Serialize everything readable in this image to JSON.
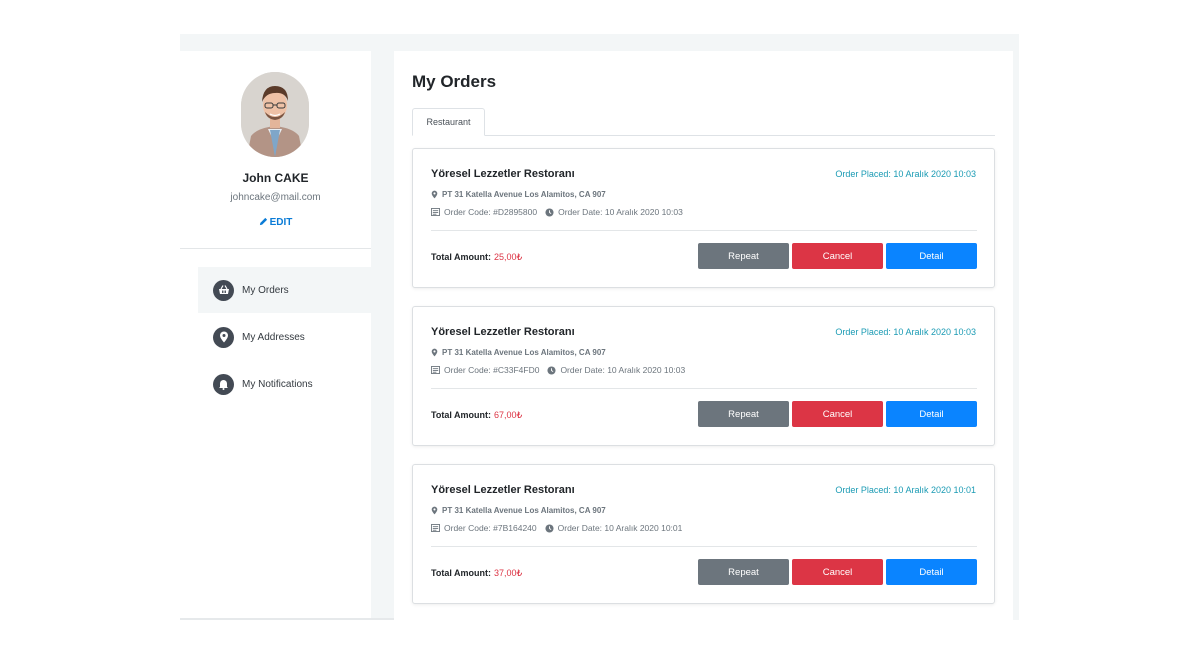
{
  "profile": {
    "name": "John CAKE",
    "email": "johncake@mail.com",
    "edit_label": "EDIT"
  },
  "sidebar": {
    "items": [
      {
        "label": "My Orders",
        "icon": "basket-icon",
        "active": true
      },
      {
        "label": "My Addresses",
        "icon": "location-pin-icon",
        "active": false
      },
      {
        "label": "My Notifications",
        "icon": "bell-icon",
        "active": false
      }
    ]
  },
  "main": {
    "title": "My Orders",
    "tabs": [
      {
        "label": "Restaurant"
      }
    ]
  },
  "orders": [
    {
      "restaurant": "Yöresel Lezzetler Restoranı",
      "placed": "Order Placed: 10 Aralık 2020 10:03",
      "address": "PT 31 Katella Avenue Los Alamitos, CA 907",
      "code": "Order Code: #D2895800",
      "date": "Order Date: 10 Aralık 2020 10:03",
      "total_label": "Total Amount:",
      "total": "25,00₺",
      "repeat": "Repeat",
      "cancel": "Cancel",
      "detail": "Detail"
    },
    {
      "restaurant": "Yöresel Lezzetler Restoranı",
      "placed": "Order Placed: 10 Aralık 2020 10:03",
      "address": "PT 31 Katella Avenue Los Alamitos, CA 907",
      "code": "Order Code: #C33F4FD0",
      "date": "Order Date: 10 Aralık 2020 10:03",
      "total_label": "Total Amount:",
      "total": "67,00₺",
      "repeat": "Repeat",
      "cancel": "Cancel",
      "detail": "Detail"
    },
    {
      "restaurant": "Yöresel Lezzetler Restoranı",
      "placed": "Order Placed: 10 Aralık 2020 10:01",
      "address": "PT 31 Katella Avenue Los Alamitos, CA 907",
      "code": "Order Code: #7B164240",
      "date": "Order Date: 10 Aralık 2020 10:01",
      "total_label": "Total Amount:",
      "total": "37,00₺",
      "repeat": "Repeat",
      "cancel": "Cancel",
      "detail": "Detail"
    }
  ],
  "colors": {
    "accent": "#0a84ff",
    "danger": "#dc3545",
    "secondary": "#6c757d",
    "info": "#1b9bb4"
  }
}
